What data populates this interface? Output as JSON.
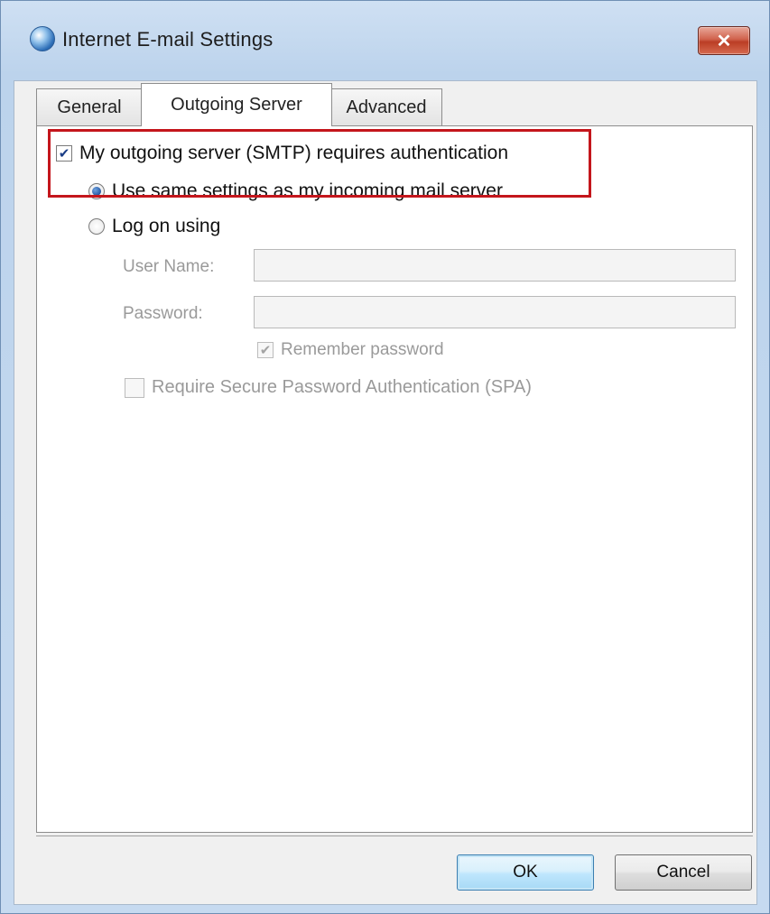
{
  "window": {
    "title": "Internet E-mail Settings"
  },
  "tabs": [
    {
      "label": "General",
      "active": false
    },
    {
      "label": "Outgoing Server",
      "active": true
    },
    {
      "label": "Advanced",
      "active": false
    }
  ],
  "outgoing": {
    "auth_checkbox": {
      "label": "My outgoing server (SMTP) requires authentication",
      "checked": true
    },
    "radio_same": {
      "label": "Use same settings as my incoming mail server",
      "selected": true
    },
    "radio_logon": {
      "label": "Log on using",
      "selected": false
    },
    "username": {
      "label": "User Name:",
      "value": ""
    },
    "password": {
      "label": "Password:",
      "value": ""
    },
    "remember_password": {
      "label": "Remember password",
      "checked": true,
      "enabled": false
    },
    "spa": {
      "label": "Require Secure Password Authentication (SPA)",
      "checked": false,
      "enabled": false
    }
  },
  "buttons": {
    "ok": "OK",
    "cancel": "Cancel"
  },
  "colors": {
    "highlight": "#c4161c",
    "close_button": "#c8452e"
  }
}
